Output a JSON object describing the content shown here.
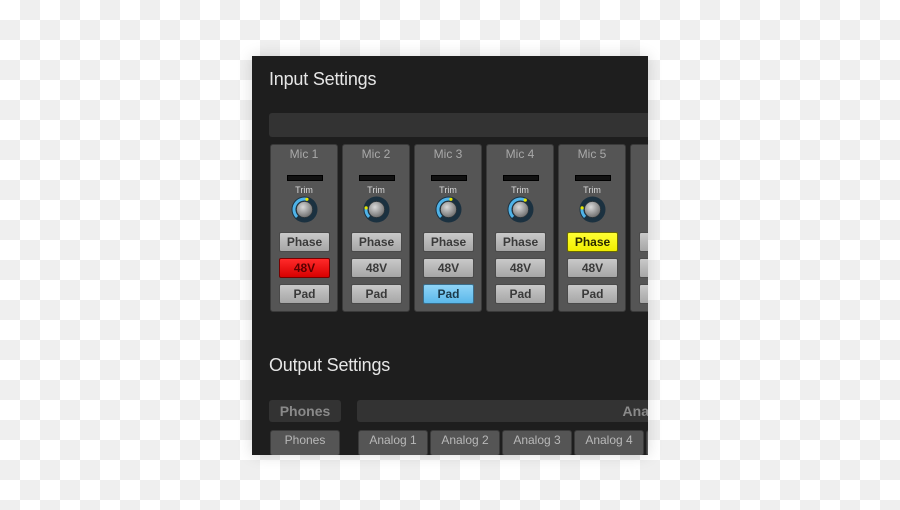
{
  "input_settings": {
    "title": "Input Settings",
    "trim_label": "Trim",
    "channels": [
      {
        "name": "Mic 1",
        "trim_fraction": 0.55,
        "phase": {
          "label": "Phase",
          "on": false
        },
        "v48": {
          "label": "48V",
          "on": true,
          "color": "#ff0000"
        },
        "pad": {
          "label": "Pad",
          "on": false
        }
      },
      {
        "name": "Mic 2",
        "trim_fraction": 0.2,
        "phase": {
          "label": "Phase",
          "on": false
        },
        "v48": {
          "label": "48V",
          "on": false
        },
        "pad": {
          "label": "Pad",
          "on": false
        }
      },
      {
        "name": "Mic 3",
        "trim_fraction": 0.55,
        "phase": {
          "label": "Phase",
          "on": false
        },
        "v48": {
          "label": "48V",
          "on": false
        },
        "pad": {
          "label": "Pad",
          "on": true,
          "color": "#6ec6f0"
        }
      },
      {
        "name": "Mic 4",
        "trim_fraction": 0.6,
        "phase": {
          "label": "Phase",
          "on": false
        },
        "v48": {
          "label": "48V",
          "on": false
        },
        "pad": {
          "label": "Pad",
          "on": false
        }
      },
      {
        "name": "Mic 5",
        "trim_fraction": 0.2,
        "phase": {
          "label": "Phase",
          "on": true,
          "color": "#ffff00"
        },
        "v48": {
          "label": "48V",
          "on": false
        },
        "pad": {
          "label": "Pad",
          "on": false
        }
      }
    ]
  },
  "output_settings": {
    "title": "Output Settings",
    "tabs": [
      {
        "label": "Phones"
      },
      {
        "label": "Ana"
      }
    ],
    "channels": [
      "Phones",
      "Analog 1",
      "Analog 2",
      "Analog 3",
      "Analog 4"
    ]
  },
  "colors": {
    "knob_arc": "#4fb3e8",
    "knob_indicator": "#e8e800"
  }
}
